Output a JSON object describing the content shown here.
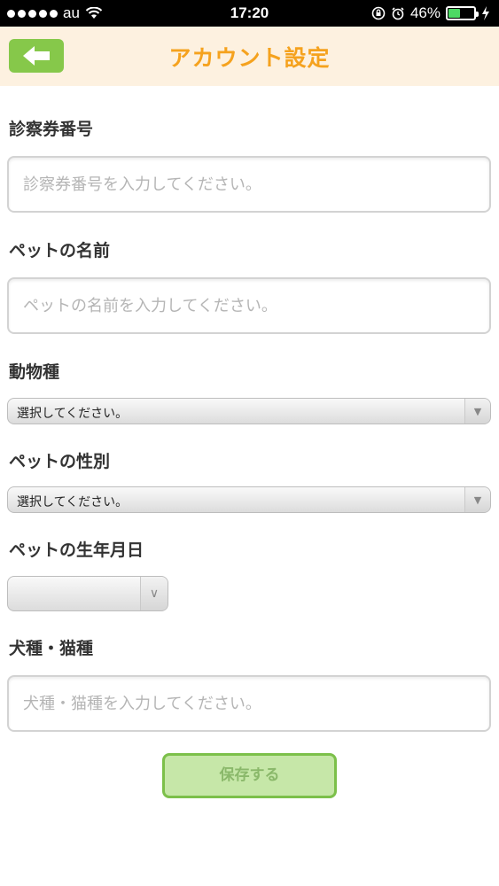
{
  "status_bar": {
    "carrier": "au",
    "time": "17:20",
    "battery": "46%",
    "battery_level": 0.46
  },
  "header": {
    "title": "アカウント設定"
  },
  "form": {
    "card_number": {
      "label": "診察券番号",
      "placeholder": "診察券番号を入力してください。"
    },
    "pet_name": {
      "label": "ペットの名前",
      "placeholder": "ペットの名前を入力してください。"
    },
    "species": {
      "label": "動物種",
      "selected": "選択してください。"
    },
    "sex": {
      "label": "ペットの性別",
      "selected": "選択してください。"
    },
    "birthday": {
      "label": "ペットの生年月日",
      "selected": ""
    },
    "breed": {
      "label": "犬種・猫種",
      "placeholder": "犬種・猫種を入力してください。"
    },
    "save_label": "保存する"
  },
  "colors": {
    "header_bg": "#fdf1e0",
    "title": "#f5a21e",
    "accent_green": "#86c84a",
    "save_bg": "#c6e7a8"
  }
}
